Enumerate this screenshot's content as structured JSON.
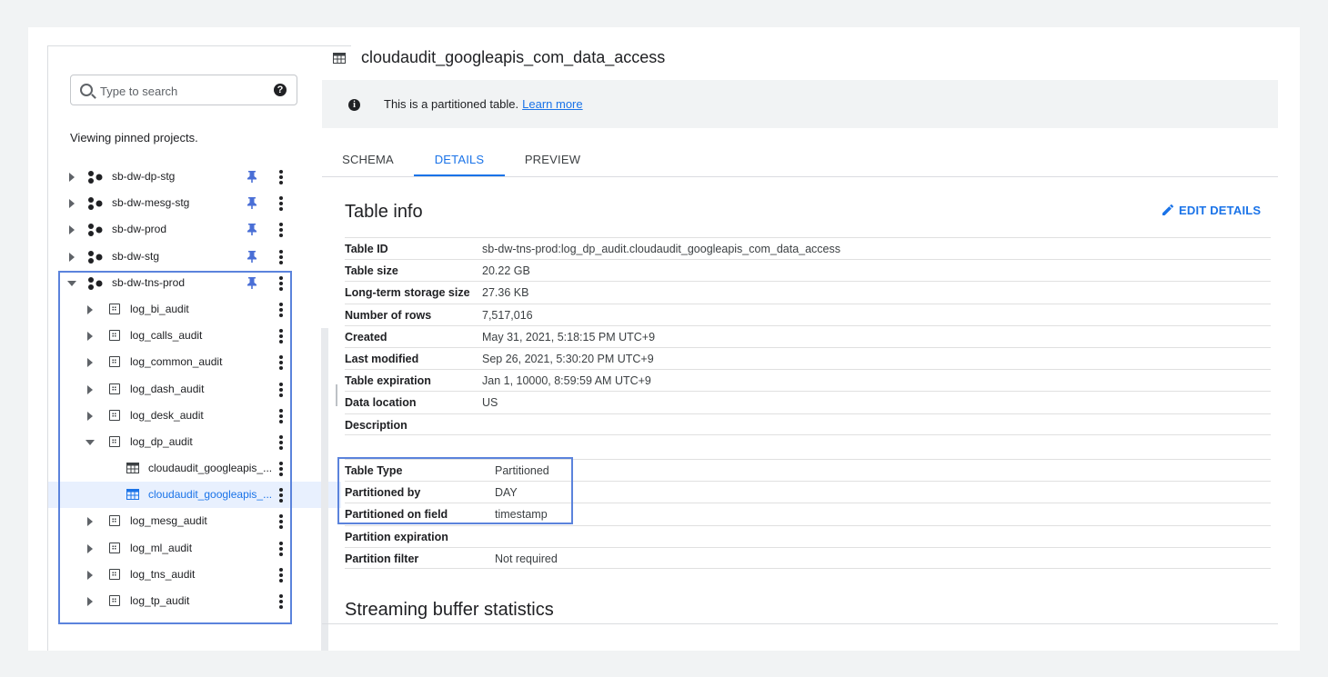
{
  "explorer": {
    "search_placeholder": "Type to search",
    "help_glyph": "?",
    "viewing_text": "Viewing pinned projects.",
    "projects": [
      {
        "name": "sb-dw-dp-stg",
        "expanded": false,
        "pinned": true
      },
      {
        "name": "sb-dw-mesg-stg",
        "expanded": false,
        "pinned": true
      },
      {
        "name": "sb-dw-prod",
        "expanded": false,
        "pinned": true
      },
      {
        "name": "sb-dw-stg",
        "expanded": false,
        "pinned": true
      },
      {
        "name": "sb-dw-tns-prod",
        "expanded": true,
        "pinned": true
      }
    ],
    "datasets": [
      {
        "name": "log_bi_audit",
        "expanded": false
      },
      {
        "name": "log_calls_audit",
        "expanded": false
      },
      {
        "name": "log_common_audit",
        "expanded": false
      },
      {
        "name": "log_dash_audit",
        "expanded": false
      },
      {
        "name": "log_desk_audit",
        "expanded": false
      },
      {
        "name": "log_dp_audit",
        "expanded": true
      },
      {
        "name": "log_mesg_audit",
        "expanded": false
      },
      {
        "name": "log_ml_audit",
        "expanded": false
      },
      {
        "name": "log_tns_audit",
        "expanded": false
      },
      {
        "name": "log_tp_audit",
        "expanded": false
      }
    ],
    "tables": [
      {
        "name": "cloudaudit_googleapis_...",
        "selected": false
      },
      {
        "name": "cloudaudit_googleapis_...",
        "selected": true
      }
    ]
  },
  "detail": {
    "title": "cloudaudit_googleapis_com_data_access",
    "banner": {
      "text": "This is a partitioned table.",
      "link": "Learn more",
      "icon_glyph": "i"
    },
    "tabs": [
      {
        "label": "SCHEMA",
        "active": false
      },
      {
        "label": "DETAILS",
        "active": true
      },
      {
        "label": "PREVIEW",
        "active": false
      }
    ],
    "table_info": {
      "heading": "Table info",
      "edit_label": "EDIT DETAILS",
      "rows": [
        {
          "key": "Table ID",
          "value": "sb-dw-tns-prod:log_dp_audit.cloudaudit_googleapis_com_data_access"
        },
        {
          "key": "Table size",
          "value": "20.22 GB"
        },
        {
          "key": "Long-term storage size",
          "value": "27.36 KB"
        },
        {
          "key": "Number of rows",
          "value": "7,517,016"
        },
        {
          "key": "Created",
          "value": "May 31, 2021, 5:18:15 PM UTC+9"
        },
        {
          "key": "Last modified",
          "value": "Sep 26, 2021, 5:30:20 PM UTC+9"
        },
        {
          "key": "Table expiration",
          "value": "Jan 1, 10000, 8:59:59 AM UTC+9"
        },
        {
          "key": "Data location",
          "value": "US"
        },
        {
          "key": "Description",
          "value": ""
        }
      ]
    },
    "partition_info": {
      "rows": [
        {
          "key": "Table Type",
          "value": "Partitioned"
        },
        {
          "key": "Partitioned by",
          "value": "DAY"
        },
        {
          "key": "Partitioned on field",
          "value": "timestamp"
        },
        {
          "key": "Partition expiration",
          "value": ""
        },
        {
          "key": "Partition filter",
          "value": "Not required"
        }
      ]
    },
    "streaming_heading": "Streaming buffer statistics"
  },
  "colors": {
    "accent": "#1a73e8",
    "highlight_box": "#5b83dc",
    "selected_row_bg": "#e8f0fe",
    "banner_bg": "#f1f3f4"
  }
}
